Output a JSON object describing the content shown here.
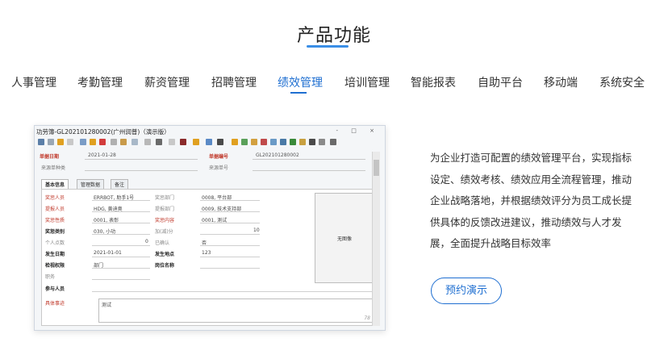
{
  "section": {
    "title": "产品功能"
  },
  "tabs": [
    {
      "label": "人事管理",
      "active": false
    },
    {
      "label": "考勤管理",
      "active": false
    },
    {
      "label": "薪资管理",
      "active": false
    },
    {
      "label": "招聘管理",
      "active": false
    },
    {
      "label": "绩效管理",
      "active": true
    },
    {
      "label": "培训管理",
      "active": false
    },
    {
      "label": "智能报表",
      "active": false
    },
    {
      "label": "自助平台",
      "active": false
    },
    {
      "label": "移动端",
      "active": false
    },
    {
      "label": "系统安全",
      "active": false
    }
  ],
  "screenshot": {
    "window_title": "功劳簿-GL202101280002(广州润普)（演示版）",
    "window_controls": "- □ ×",
    "header": {
      "date_label": "单据日期",
      "date_value": "2021-01-28",
      "doc_no_label": "单据编号",
      "doc_no_value": "GL202101280002",
      "source_type_label": "来源单种类",
      "source_no_label": "来源单号"
    },
    "subtabs": [
      "基本信息",
      "管理数据",
      "备注"
    ],
    "fields": {
      "reward_person_label": "奖惩人员",
      "reward_person_value": "ERRBOT, 助手1号",
      "reward_dept_label": "奖惩部门",
      "reward_dept_value": "0008, 平台部",
      "reporter_label": "提报人员",
      "reporter_value": "HDG, 黄迪奥",
      "report_dept_label": "提报部门",
      "report_dept_value": "0009, 技术支持部",
      "nature_label": "奖惩性质",
      "nature_value": "0001, 表彰",
      "content_label": "奖惩内容",
      "content_value": "0001, 测试",
      "category_label": "奖惩类别",
      "category_value": "030, 小功",
      "points_label": "加(减)分",
      "points_value": "10",
      "personal_points_label": "个人点数",
      "personal_points_value": "0",
      "confirmed_label": "已确认",
      "confirmed_value": "否",
      "occur_date_label": "发生日期",
      "occur_date_value": "2021-01-01",
      "location_label": "发生地点",
      "location_value": "123",
      "permission_label": "检视权限",
      "permission_value": "部门",
      "position_label": "岗位名称",
      "duty_label": "职务",
      "participants_label": "参与人员",
      "details_label": "具体事迹",
      "details_value": "测试",
      "details_count": "78",
      "no_image": "无图像"
    }
  },
  "description": "为企业打造可配置的绩效管理平台，实现指标设定、绩效考核、绩效应用全流程管理，推动企业战略落地，并根据绩效评分为员工成长提供具体的反馈改进建议，推动绩效与人才发展，全面提升战略目标效率",
  "cta": {
    "label": "预约演示"
  },
  "colors": {
    "accent": "#1f6fd1",
    "underline": "#3a8ee6",
    "required_label": "#c0392b"
  }
}
